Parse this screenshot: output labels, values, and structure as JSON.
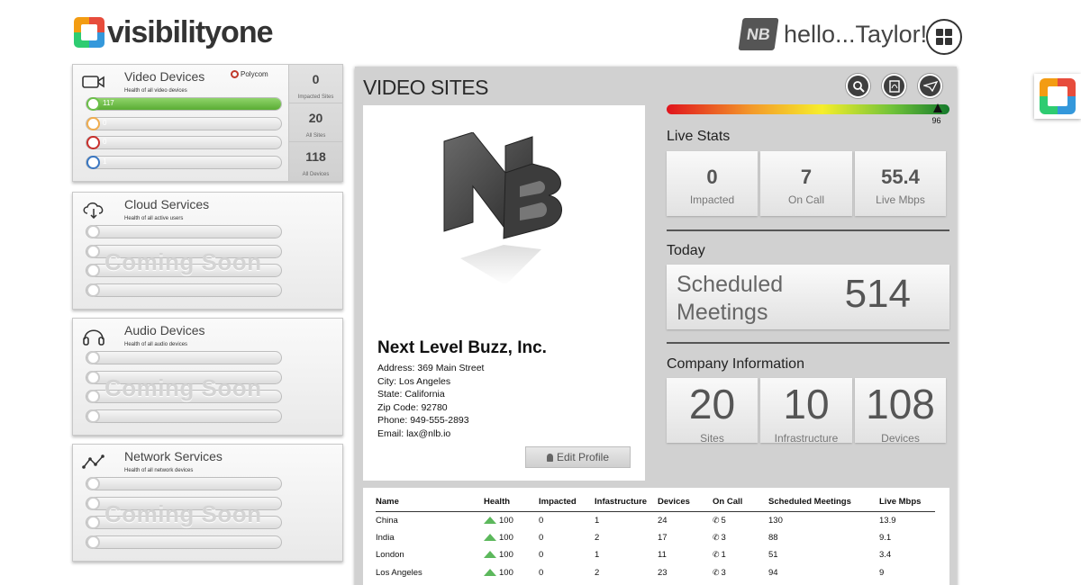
{
  "header": {
    "logo_text": "visibilityone",
    "greeting": "hello...Taylor!",
    "user_logo_text": "NB"
  },
  "services": [
    {
      "title": "Video Devices",
      "subtitle": "Health of all video devices",
      "icon": "video-camera-icon",
      "vendor": "Polycom",
      "bars": [
        {
          "value": "117",
          "color": "#6cc04a"
        },
        {
          "value": "0",
          "color": "#f0ad4e"
        },
        {
          "value": "0",
          "color": "#c9302c"
        },
        {
          "value": "1",
          "color": "#3a78c2"
        }
      ],
      "stats": [
        {
          "value": "0",
          "label": "Impacted Sites"
        },
        {
          "value": "20",
          "label": "All Sites"
        },
        {
          "value": "118",
          "label": "All Devices"
        }
      ]
    },
    {
      "title": "Cloud Services",
      "subtitle": "Health of all active users",
      "icon": "cloud-download-icon",
      "coming": "Coming Soon"
    },
    {
      "title": "Audio Devices",
      "subtitle": "Health of all audio devices",
      "icon": "headphones-icon",
      "coming": "Coming Soon"
    },
    {
      "title": "Network Services",
      "subtitle": "Health of all network devices",
      "icon": "network-graph-icon",
      "coming": "Coming Soon"
    }
  ],
  "main": {
    "title": "VIDEO SITES",
    "tools": [
      "search-icon",
      "pdf-icon",
      "send-icon"
    ],
    "profile": {
      "company": "Next Level Buzz, Inc.",
      "address": "Address: 369 Main Street",
      "city": "City: Los Angeles",
      "state": "State: California",
      "zip": "Zip Code: 92780",
      "phone": "Phone: 949-555-2893",
      "email": "Email: lax@nlb.io",
      "edit_label": "Edit Profile"
    },
    "health_score": 96,
    "live_stats": {
      "heading": "Live Stats",
      "items": [
        {
          "value": "0",
          "label": "Impacted"
        },
        {
          "value": "7",
          "label": "On Call"
        },
        {
          "value": "55.4",
          "label": "Live Mbps"
        }
      ]
    },
    "today": {
      "heading": "Today",
      "label": "Scheduled Meetings",
      "value": "514"
    },
    "company_info": {
      "heading": "Company Information",
      "items": [
        {
          "value": "20",
          "label": "Sites"
        },
        {
          "value": "10",
          "label": "Infrastructure"
        },
        {
          "value": "108",
          "label": "Devices"
        }
      ]
    },
    "table": {
      "columns": [
        "Name",
        "Health",
        "Impacted",
        "Infastructure",
        "Devices",
        "On Call",
        "Scheduled Meetings",
        "Live Mbps"
      ],
      "rows": [
        {
          "name": "China",
          "health": "100",
          "impacted": "0",
          "infra": "1",
          "devices": "24",
          "oncall": "5",
          "meetings": "130",
          "mbps": "13.9"
        },
        {
          "name": "India",
          "health": "100",
          "impacted": "0",
          "infra": "2",
          "devices": "17",
          "oncall": "3",
          "meetings": "88",
          "mbps": "9.1"
        },
        {
          "name": "London",
          "health": "100",
          "impacted": "0",
          "infra": "1",
          "devices": "11",
          "oncall": "1",
          "meetings": "51",
          "mbps": "3.4"
        },
        {
          "name": "Los Angeles",
          "health": "100",
          "impacted": "0",
          "infra": "2",
          "devices": "23",
          "oncall": "3",
          "meetings": "94",
          "mbps": "9"
        }
      ]
    }
  }
}
